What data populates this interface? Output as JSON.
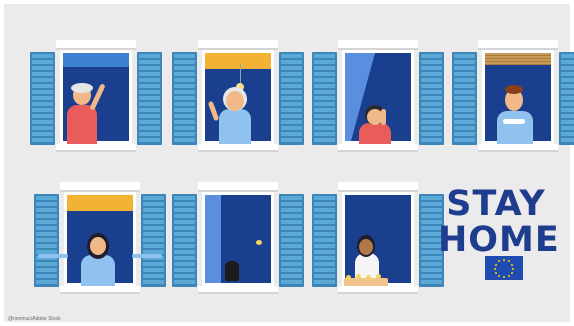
{
  "credit": "@nenmuc/Adobe Stock",
  "headline": [
    "STAY",
    "HOME"
  ],
  "colors": {
    "background": "#ebebeb",
    "shutter": "#5aa9d6",
    "window_interior": "#1b3f8f",
    "text": "#1e3d8f",
    "eu_flag": "#1f4bb0",
    "eu_stars": "#ffd400"
  },
  "windows": [
    {
      "id": "w1",
      "scene": "elderly-man-waving",
      "blind": "blue-roller"
    },
    {
      "id": "w2",
      "scene": "elderly-woman-waving",
      "blind": "yellow-roller"
    },
    {
      "id": "w3",
      "scene": "girl-drinking",
      "blind": "blue-curtain"
    },
    {
      "id": "w4",
      "scene": "man-with-cup",
      "blind": "wooden-slat"
    },
    {
      "id": "w5",
      "scene": "woman-arms-open",
      "blind": "yellow-roller"
    },
    {
      "id": "w6",
      "scene": "cat-and-bird",
      "blind": "blue-curtain"
    },
    {
      "id": "w7",
      "scene": "woman-watering-plants",
      "blind": "none"
    }
  ],
  "icons": [
    "eu-flag-icon"
  ]
}
